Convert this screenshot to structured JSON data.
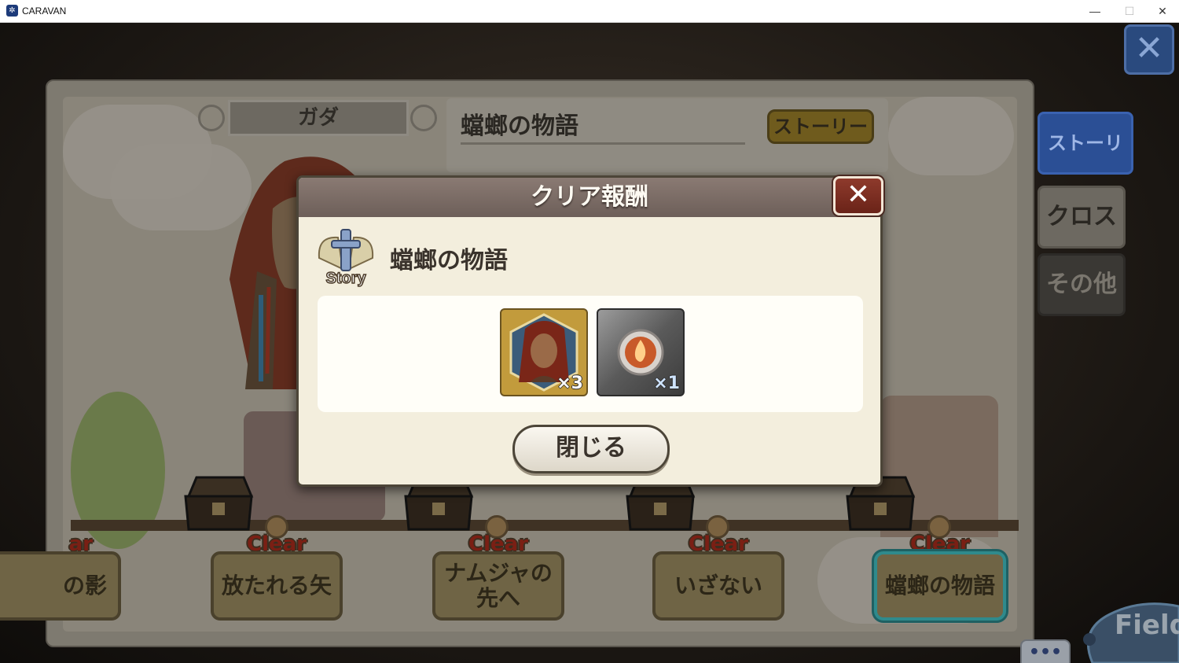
{
  "window": {
    "title": "CARAVAN",
    "icon": "caravan-app-icon",
    "controls": {
      "minimize": "—",
      "maximize": "☐",
      "close": "✕"
    }
  },
  "game": {
    "character_name": "ガダ",
    "story_title": "蟷螂の物語",
    "story_button": "ストーリー",
    "top_close_symbol": "✕",
    "side_tabs": [
      {
        "label": "ストーリー",
        "selected": true
      },
      {
        "label": "クロス",
        "selected": false
      },
      {
        "label": "その他",
        "selected": false
      }
    ],
    "stages": [
      {
        "label_line1": "の影",
        "label_line2": "",
        "clear": "ar"
      },
      {
        "label_line1": "放たれる矢",
        "label_line2": "",
        "clear": "Clear"
      },
      {
        "label_line1": "ナムジャの",
        "label_line2": "先へ",
        "clear": "Clear"
      },
      {
        "label_line1": "いざない",
        "label_line2": "",
        "clear": "Clear"
      },
      {
        "label_line1": "蟷螂の物語",
        "label_line2": "",
        "clear": "Clear",
        "active": true
      }
    ],
    "field_button": "Field",
    "more_button": "•••"
  },
  "dialog": {
    "title": "クリア報酬",
    "close_symbol": "✕",
    "emblem_text": "Story",
    "stage_name": "蟷螂の物語",
    "rewards": [
      {
        "type": "character-card",
        "quantity": "×3"
      },
      {
        "type": "fire-orb",
        "quantity": "×1"
      }
    ],
    "close_button": "閉じる"
  },
  "colors": {
    "dialog_header": "#7a6b65",
    "dialog_close": "#7a2b1f",
    "tab_selected": "#2b4f95",
    "clear_red": "#7a1f14"
  }
}
